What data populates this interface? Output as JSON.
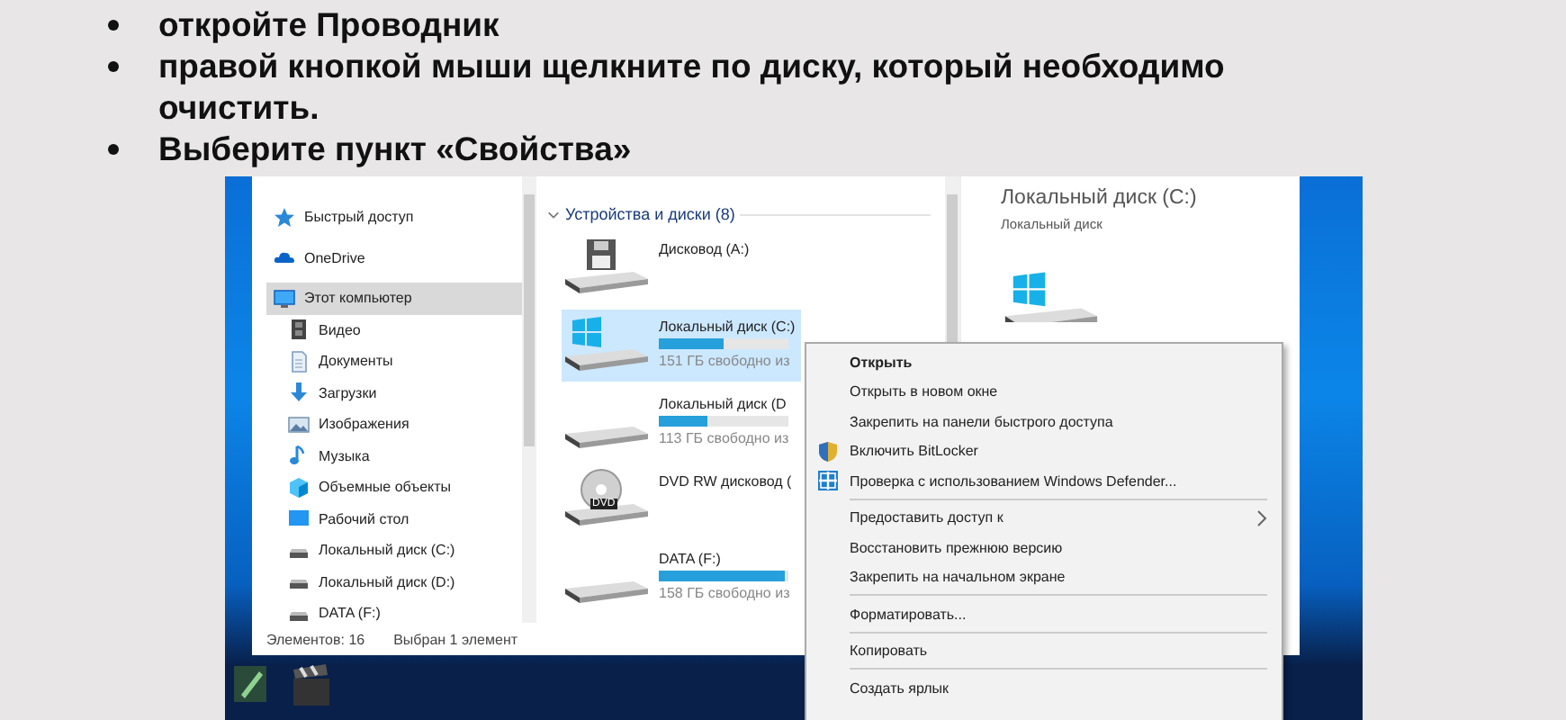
{
  "slide": {
    "bullets": [
      "откройте Проводник",
      "правой кнопкой мыши щелкните по диску, который необходимо очистить.",
      "Выберите пункт «Свойства»"
    ]
  },
  "explorer": {
    "navigation": [
      {
        "label": "Быстрый доступ",
        "selected": false
      },
      {
        "label": "OneDrive",
        "selected": false
      },
      {
        "label": "Этот компьютер",
        "selected": true,
        "children": [
          {
            "label": "Видео",
            "selected": false
          },
          {
            "label": "Документы",
            "selected": false
          },
          {
            "label": "Загрузки",
            "selected": false
          },
          {
            "label": "Изображения",
            "selected": false
          },
          {
            "label": "Музыка",
            "selected": false
          },
          {
            "label": "Объемные объекты",
            "selected": false
          },
          {
            "label": "Рабочий стол",
            "selected": false
          },
          {
            "label": "Локальный диск (C:)",
            "selected": false
          },
          {
            "label": "Локальный диск (D:)",
            "selected": false
          },
          {
            "label": "DATA (F:)",
            "selected": false
          }
        ]
      }
    ],
    "status_bar": [
      "Элементов: 16",
      "Выбран 1 элемент"
    ],
    "group": {
      "title": "Устройства и диски (8)",
      "expanded": true
    },
    "drives": [
      {
        "name": "Дисковод (A:)",
        "kind": "floppy",
        "selected": false
      },
      {
        "name": "Локальный диск (C:)",
        "kind": "system",
        "selected": true,
        "level": 0.5,
        "free": "151 ГБ свободно из"
      },
      {
        "name": "Локальный диск (D",
        "kind": "disk",
        "selected": false,
        "level": 0.37,
        "free": "113 ГБ свободно из"
      },
      {
        "name": "DVD RW дисковод (",
        "kind": "dvd",
        "badge": "DVD",
        "selected": false
      },
      {
        "name": "DATA (F:)",
        "kind": "disk",
        "selected": false,
        "level": 0.97,
        "free": "158 ГБ свободно из"
      }
    ],
    "preview": {
      "title": "Локальный диск (C:)",
      "subtitle": "Локальный диск"
    }
  },
  "context_menu": {
    "groups": [
      [
        {
          "label": "Открыть",
          "default": true,
          "submenu": false
        },
        {
          "label": "Открыть в новом окне",
          "default": false,
          "submenu": false
        },
        {
          "label": "Закрепить на панели быстрого доступа",
          "default": false,
          "submenu": false
        },
        {
          "label": "Включить BitLocker",
          "default": false,
          "submenu": false
        },
        {
          "label": "Проверка с использованием Windows Defender...",
          "default": false,
          "submenu": false
        }
      ],
      [
        {
          "label": "Предоставить доступ к",
          "default": false,
          "submenu": true
        },
        {
          "label": "Восстановить прежнюю версию",
          "default": false,
          "submenu": false
        },
        {
          "label": "Закрепить на начальном экране",
          "default": false,
          "submenu": false
        }
      ],
      [
        {
          "label": "Форматировать...",
          "default": false,
          "submenu": false
        }
      ],
      [
        {
          "label": "Копировать",
          "default": false,
          "submenu": false
        }
      ],
      [
        {
          "label": "Создать ярлык",
          "default": false,
          "submenu": false
        }
      ]
    ]
  }
}
